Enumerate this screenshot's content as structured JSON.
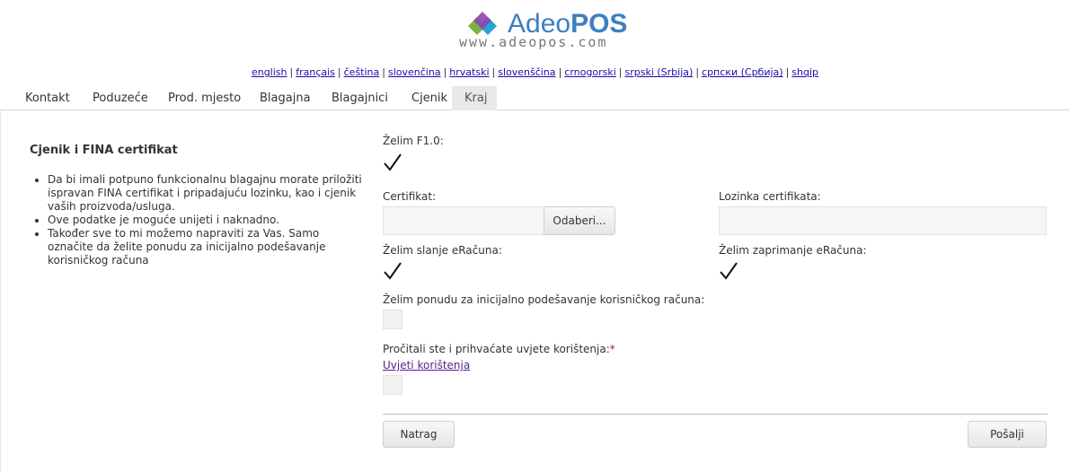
{
  "logo": {
    "name_a": "Adeo",
    "name_b": "POS",
    "url": "www.adeopos.com"
  },
  "languages": [
    "english",
    "français",
    "čeština",
    "slovenčina",
    "hrvatski",
    "slovenščina",
    "crnogorski",
    "srpski (Srbija)",
    "српски (Србија)",
    "shqip"
  ],
  "tabs": [
    "Kontakt",
    "Poduzeće",
    "Prod. mjesto",
    "Blagajna",
    "Blagajnici",
    "Cjenik",
    "Kraj"
  ],
  "active_tab": "Kraj",
  "sidebar": {
    "title": "Cjenik i FINA certifikat",
    "bullets": [
      "Da bi imali potpuno funkcionalnu blagajnu morate priložiti ispravan FINA certifikat i pripadajuću lozinku, kao i cjenik vaših proizvoda/usluga.",
      "Ove podatke je moguće unijeti i naknadno.",
      "Također sve to mi možemo napraviti za Vas. Samo označite da želite ponudu za inicijalno podešavanje korisničkog računa"
    ]
  },
  "form": {
    "f10_label": "Želim F1.0:",
    "f10_checked": true,
    "cert_label": "Certifikat:",
    "cert_button": "Odaberi...",
    "cert_value": "",
    "cert_pass_label": "Lozinka certifikata:",
    "cert_pass_value": "",
    "send_einvoice_label": "Želim slanje eRačuna:",
    "send_einvoice_checked": true,
    "receive_einvoice_label": "Želim zaprimanje eRačuna:",
    "receive_einvoice_checked": true,
    "offer_label": "Želim ponudu za inicijalno podešavanje korisničkog računa:",
    "offer_checked": false,
    "terms_label": "Pročitali ste i prihvaćate uvjete korištenja:",
    "terms_required_mark": "*",
    "terms_link": "Uvjeti korištenja",
    "terms_checked": false
  },
  "buttons": {
    "back": "Natrag",
    "send": "Pošalji"
  },
  "colors": {
    "link": "#1a0dab",
    "visited_link": "#5b1f8f",
    "required": "#d9000d",
    "logo_blue": "#3d7fc1"
  }
}
